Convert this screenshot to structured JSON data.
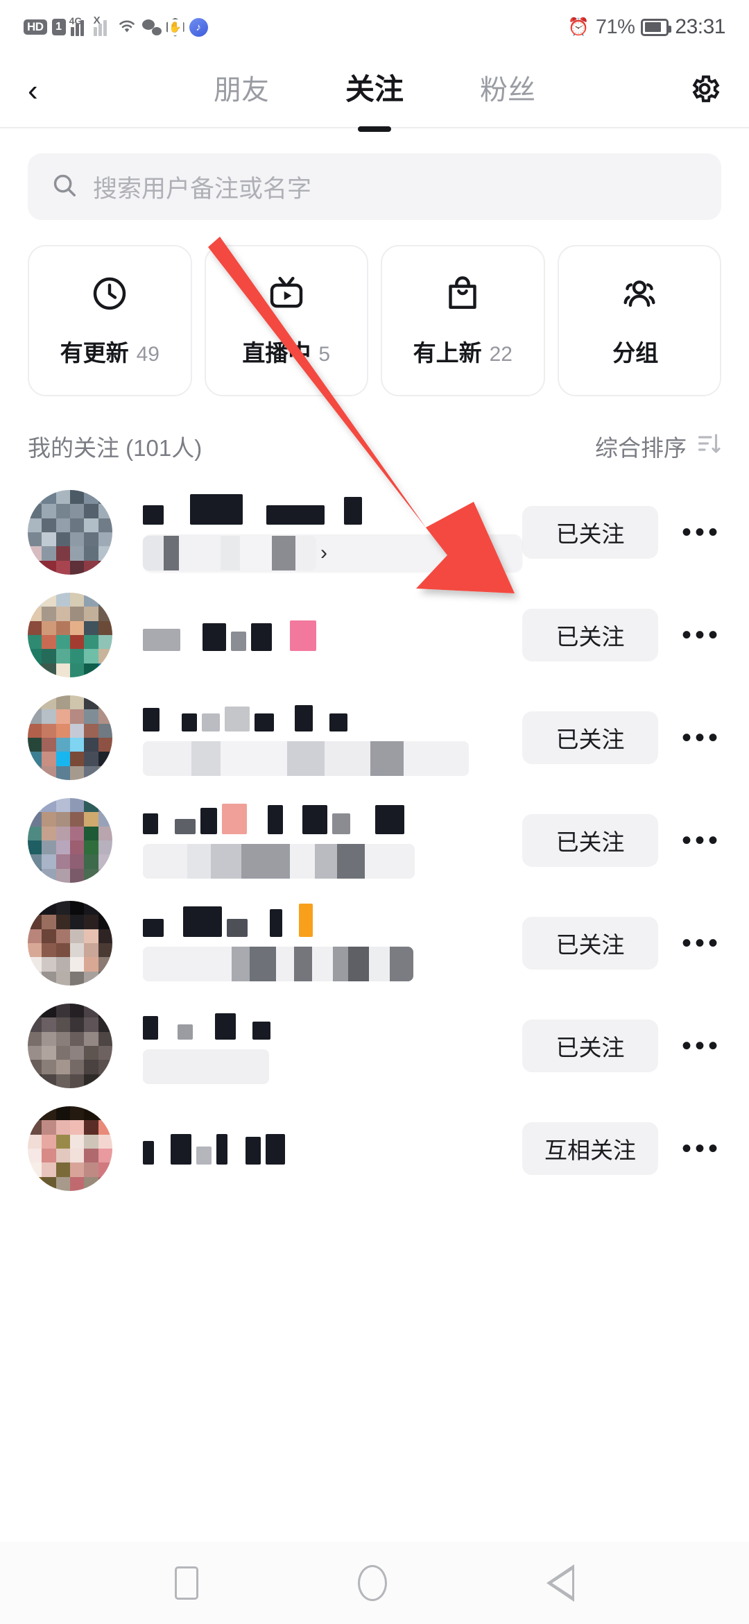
{
  "status_bar": {
    "hd_label": "HD",
    "sim_label": "1",
    "network_label": "4G",
    "no_signal_label": "X",
    "icons": [
      "hd-icon",
      "sim-card-icon",
      "signal-4g-icon",
      "signal-no-service-icon",
      "wifi-icon",
      "wechat-icon",
      "hand-gesture-icon",
      "music-icon"
    ],
    "alarm_icon": "⏰",
    "battery_percent": "71%",
    "time": "23:31"
  },
  "header": {
    "back_icon": "‹",
    "settings_icon": "gear-icon",
    "tabs": [
      {
        "label": "朋友",
        "active": false
      },
      {
        "label": "关注",
        "active": true
      },
      {
        "label": "粉丝",
        "active": false
      }
    ]
  },
  "search": {
    "icon": "search-icon",
    "placeholder": "搜索用户备注或名字",
    "value": ""
  },
  "quick_cards": [
    {
      "icon": "clock-icon",
      "label": "有更新",
      "count": "49"
    },
    {
      "icon": "live-tv-icon",
      "label": "直播中",
      "count": "5"
    },
    {
      "icon": "shopping-bag-icon",
      "label": "有上新",
      "count": "22"
    },
    {
      "icon": "group-users-icon",
      "label": "分组",
      "count": ""
    }
  ],
  "list_header": {
    "title": "我的关注 (101人)",
    "sort_label": "综合排序",
    "sort_icon": "sort-filter-icon"
  },
  "list_rows": [
    {
      "name_redacted": true,
      "has_subtitle": true,
      "subtitle_kind": "pill",
      "follow_label": "已关注",
      "more_label": "•••"
    },
    {
      "name_redacted": true,
      "has_subtitle": false,
      "subtitle_kind": "none",
      "follow_label": "已关注",
      "more_label": "•••"
    },
    {
      "name_redacted": true,
      "has_subtitle": true,
      "subtitle_kind": "bar",
      "follow_label": "已关注",
      "more_label": "•••"
    },
    {
      "name_redacted": true,
      "has_subtitle": true,
      "subtitle_kind": "bar",
      "follow_label": "已关注",
      "more_label": "•••"
    },
    {
      "name_redacted": true,
      "has_subtitle": true,
      "subtitle_kind": "bar",
      "follow_label": "已关注",
      "more_label": "•••"
    },
    {
      "name_redacted": true,
      "has_subtitle": true,
      "subtitle_kind": "bar",
      "follow_label": "已关注",
      "more_label": "•••"
    },
    {
      "name_redacted": true,
      "has_subtitle": false,
      "subtitle_kind": "none",
      "follow_label": "互相关注",
      "more_label": "•••"
    }
  ],
  "annotation": {
    "arrow_color": "#f4483f",
    "arrow_from": "直播中 card",
    "arrow_to": "first row 已关注 button"
  },
  "nav_bar": {
    "recents_icon": "square-icon",
    "home_icon": "circle-icon",
    "back_icon": "triangle-back-icon"
  }
}
